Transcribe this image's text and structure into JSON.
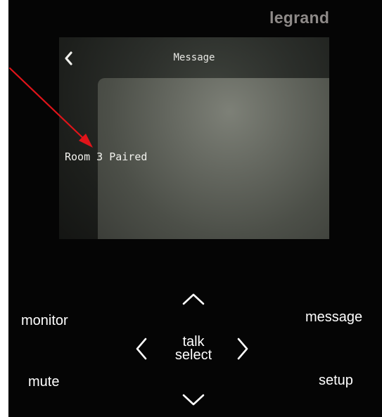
{
  "device": {
    "brand": "legrand"
  },
  "screen": {
    "title": "Message",
    "message": "Room 3 Paired",
    "back_icon": "chevron-left-icon"
  },
  "buttons": {
    "monitor": "monitor",
    "mute": "mute",
    "message": "message",
    "setup": "setup",
    "talk": "talk",
    "select": "select",
    "up_icon": "chevron-up-icon",
    "down_icon": "chevron-down-icon",
    "left_icon": "chevron-left-icon",
    "right_icon": "chevron-right-icon"
  },
  "annotation": {
    "arrow_color": "#e0141a"
  },
  "colors": {
    "panel": "#050505",
    "brand": "#8e8a88",
    "text": "#ffffff"
  }
}
